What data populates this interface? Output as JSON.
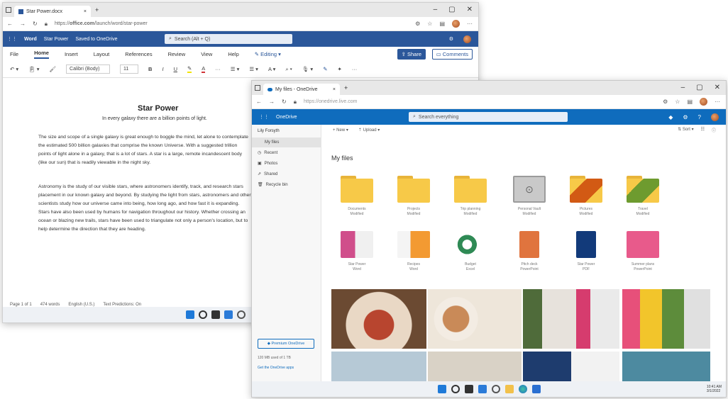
{
  "word": {
    "tab_title": "Star Power.docx",
    "url_prefix": "https://",
    "url_domain": "office.com",
    "url_rest": "/launch/word/star-power",
    "app_name": "Word",
    "doc_name": "Star Power",
    "save_state": "Saved to OneDrive",
    "search_placeholder": "Search (Alt + Q)",
    "menu": [
      "File",
      "Home",
      "Insert",
      "Layout",
      "References",
      "Review",
      "View",
      "Help"
    ],
    "editing": "Editing",
    "share": "Share",
    "comments": "Comments",
    "font_name": "Calibri (Body)",
    "font_size": "11",
    "doc_title": "Star Power",
    "doc_subtitle": "In every galaxy there are a billion points of light.",
    "para1": "The size and scope of a single galaxy is great enough to boggle the mind, let alone to contemplate the estimated 500 billion galaxies that comprise the known Universe. With a suggested trillion points of light alone in a galaxy, that is a lot of stars. A star is a large, remote incandescent body (like our sun) that is readily viewable in the night sky.",
    "para2": "Astronomy is the study of our visible stars, where astronomers identify, track, and research stars placement in our known galaxy and beyond. By studying the light from stars, astronomers and other scientists study how our universe came into being, how long ago, and how fast it is expanding. Stars have also been used by humans for navigation throughout our history. Whether crossing an ocean or blazing new trails, stars have been used to triangulate not only a person's location, but to help determine the direction that they are heading.",
    "status": [
      "Page 1 of 1",
      "474 words",
      "English (U.S.)",
      "Text Predictions: On"
    ]
  },
  "onedrive": {
    "tab_title": "My files - OneDrive",
    "url": "https://onedrive.live.com",
    "app_name": "OneDrive",
    "search_placeholder": "Search everything",
    "owner": "Lily Forsyth",
    "nav": [
      "My files",
      "Recent",
      "Photos",
      "Shared",
      "Recycle bin"
    ],
    "cmd_new": "New",
    "cmd_upload": "Upload",
    "cmd_sort": "Sort",
    "heading": "My files",
    "folders": [
      {
        "name": "Documents",
        "detail": "Modified"
      },
      {
        "name": "Projects",
        "detail": "Modified"
      },
      {
        "name": "Trip planning",
        "detail": "Modified"
      },
      {
        "name": "Personal Vault",
        "detail": "Modified"
      },
      {
        "name": "Pictures",
        "detail": "Modified"
      },
      {
        "name": "Travel",
        "detail": "Modified"
      }
    ],
    "files": [
      {
        "name": "Star Power",
        "detail": "Word"
      },
      {
        "name": "Recipes",
        "detail": "Word"
      },
      {
        "name": "Budget",
        "detail": "Excel"
      },
      {
        "name": "Pitch deck",
        "detail": "PowerPoint"
      },
      {
        "name": "Star Power",
        "detail": "PDF"
      },
      {
        "name": "Summer plans",
        "detail": "PowerPoint"
      }
    ],
    "premium": "Premium OneDrive",
    "storage": "120 MB used of 1 TB",
    "get_apps": "Get the OneDrive apps",
    "clock_time": "10:41 AM",
    "clock_date": "3/1/2022"
  },
  "colors": {
    "word_blue": "#2b579a",
    "onedrive_blue": "#0f6cbd",
    "folder_yellow": "#f7c948"
  }
}
